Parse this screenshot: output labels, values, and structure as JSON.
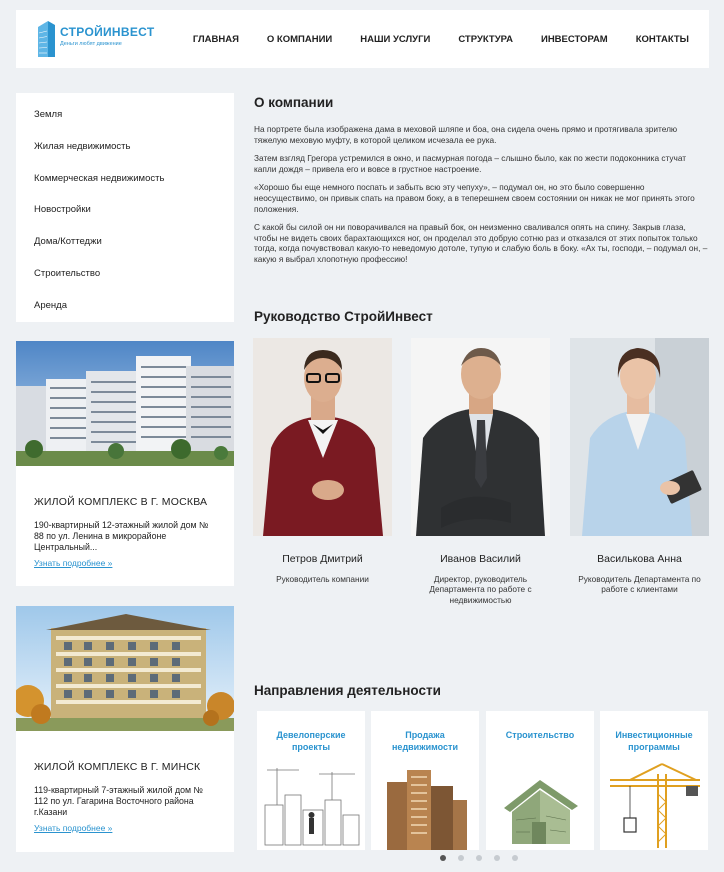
{
  "header": {
    "logo_title": "СТРОЙИНВЕСТ",
    "logo_tagline": "Деньги любят движение",
    "nav": [
      "ГЛАВНАЯ",
      "О КОМПАНИИ",
      "НАШИ УСЛУГИ",
      "СТРУКТУРА",
      "ИНВЕСТОРАМ",
      "КОНТАКТЫ"
    ]
  },
  "sidebar": {
    "items": [
      "Земля",
      "Жилая недвижимость",
      "Коммерческая недвижимость",
      "Новостройки",
      "Дома/Коттеджи",
      "Строительство",
      "Аренда"
    ]
  },
  "cards": [
    {
      "title": "ЖИЛОЙ КОМПЛЕКС В Г. МОСКВА",
      "desc": "190-квартирный 12-этажный жилой дом № 88 по ул. Ленина в микрорайоне Центральный...",
      "link": "Узнать подробнее »"
    },
    {
      "title": "ЖИЛОЙ КОМПЛЕКС В Г. МИНСК",
      "desc": "119-квартирный 7-этажный жилой дом № 112 по ул. Гагарина Восточного района г.Казани",
      "link": "Узнать подробнее »"
    }
  ],
  "about": {
    "title": "О компании",
    "paragraphs": [
      "На портрете была изображена дама в меховой шляпе и боа, она сидела очень прямо и протягивала зрителю тяжелую меховую муфту, в которой целиком исчезала ее рука.",
      "Затем взгляд Грегора устремился в окно, и пасмурная погода – слышно было, как по жести подоконника стучат капли дождя – привела его и вовсе в грустное настроение.",
      "«Хорошо бы еще немного поспать и забыть всю эту чепуху», – подумал он, но это было совершенно неосуществимо, он привык спать на правом боку, а в теперешнем своем состоянии он никак не мог принять этого положения.",
      "С какой бы силой он ни поворачивался на правый бок, он неизменно сваливался опять на спину. Закрыв глаза, чтобы не видеть своих барахтающихся ног, он проделал это добрую сотню раз и отказался от этих попыток только тогда, когда почувствовал какую-то неведомую дотоле, тупую и слабую боль в боку. «Ах ты, господи, – подумал он, – какую я выбрал хлопотную профессию!"
    ]
  },
  "team": {
    "title": "Руководство СтройИнвест",
    "people": [
      {
        "name": "Петров Дмитрий",
        "role": "Руководитель компании"
      },
      {
        "name": "Иванов Василий",
        "role": "Директор, руководитель Департамента по работе с недвижимостью"
      },
      {
        "name": "Василькова Анна",
        "role": "Руководитель Департамента по работе с клиентами"
      }
    ]
  },
  "directions": {
    "title": "Направления деятельности",
    "items": [
      "Девелоперские проекты",
      "Продажа недвижимости",
      "Строительство",
      "Инвестиционные программы"
    ],
    "slider_pages": 5,
    "active_page": 1
  },
  "colors": {
    "accent": "#2a93cf",
    "background": "#eef1f4"
  }
}
